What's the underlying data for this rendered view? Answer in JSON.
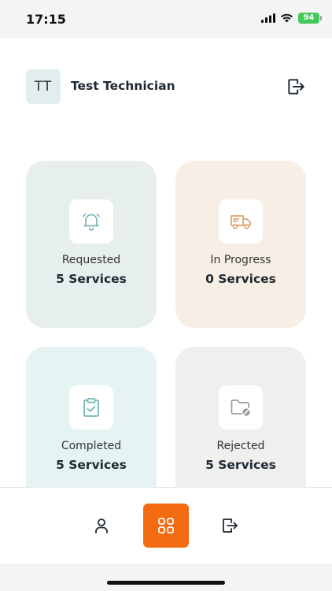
{
  "status_bar": {
    "time": "17:15",
    "battery": "94"
  },
  "header": {
    "avatar_initials": "TT",
    "user_name": "Test Technician"
  },
  "cards": [
    {
      "label": "Requested",
      "count": "5 Services",
      "icon": "bell-icon",
      "bg": "#e7eeee",
      "icon_color": "#7bb5b5"
    },
    {
      "label": "In Progress",
      "count": "0 Services",
      "icon": "truck-icon",
      "bg": "#f7efe5",
      "icon_color": "#dca46a"
    },
    {
      "label": "Completed",
      "count": "5 Services",
      "icon": "clipboard-check-icon",
      "bg": "#e6f3f3",
      "icon_color": "#6fb5b5"
    },
    {
      "label": "Rejected",
      "count": "5 Services",
      "icon": "folder-blocked-icon",
      "bg": "#efefed",
      "icon_color": "#9b9b96"
    }
  ],
  "bottom_nav": {
    "items": [
      {
        "icon": "user-icon"
      },
      {
        "icon": "grid-icon",
        "active": true
      },
      {
        "icon": "logout-icon"
      }
    ],
    "accent": "#f46c12"
  }
}
